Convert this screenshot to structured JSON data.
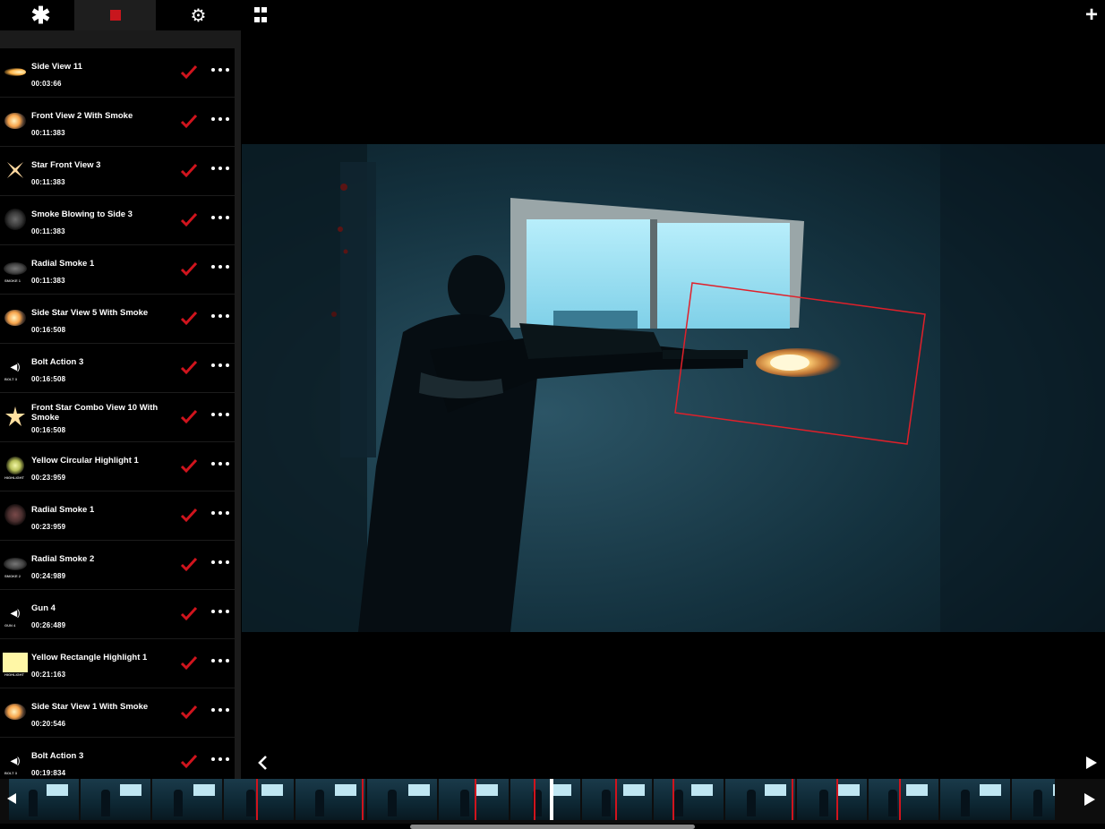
{
  "topbar": {
    "tabs": [
      {
        "name": "effects-tab",
        "glyph": "✱"
      },
      {
        "name": "record-tab",
        "glyph": ""
      },
      {
        "name": "settings-tab",
        "glyph": "⚙"
      }
    ],
    "plus_glyph": "+"
  },
  "effects": [
    {
      "name": "Side View 11",
      "time": "00:03:66",
      "thumb": "flash",
      "caption": ""
    },
    {
      "name": "Front View 2 With Smoke",
      "time": "00:11:383",
      "thumb": "smoke-flash",
      "caption": ""
    },
    {
      "name": "Star Front View 3",
      "time": "00:11:383",
      "thumb": "star-x",
      "caption": ""
    },
    {
      "name": "Smoke Blowing to Side 3",
      "time": "00:11:383",
      "thumb": "smoke",
      "caption": ""
    },
    {
      "name": "Radial Smoke 1",
      "time": "00:11:383",
      "thumb": "cloud",
      "caption": "SMOKE 1"
    },
    {
      "name": "Side Star View 5 With Smoke",
      "time": "00:16:508",
      "thumb": "smoke-flash",
      "caption": ""
    },
    {
      "name": "Bolt Action 3",
      "time": "00:16:508",
      "thumb": "speaker",
      "caption": "BOLT 3"
    },
    {
      "name": "Front Star Combo View 10 With Smoke",
      "time": "00:16:508",
      "thumb": "star",
      "caption": ""
    },
    {
      "name": "Yellow Circular Highlight 1",
      "time": "00:23:959",
      "thumb": "glow",
      "caption": "HIGHLIGHT"
    },
    {
      "name": "Radial Smoke 1",
      "time": "00:23:959",
      "thumb": "redsmoke",
      "caption": ""
    },
    {
      "name": "Radial Smoke 2",
      "time": "00:24:989",
      "thumb": "cloud",
      "caption": "SMOKE 2"
    },
    {
      "name": "Gun 4",
      "time": "00:26:489",
      "thumb": "speaker",
      "caption": "GUN 4"
    },
    {
      "name": "Yellow Rectangle Highlight 1",
      "time": "00:21:163",
      "thumb": "yellowrect",
      "caption": "HIGHLIGHT"
    },
    {
      "name": "Side Star View 1 With Smoke",
      "time": "00:20:546",
      "thumb": "smoke-flash",
      "caption": ""
    },
    {
      "name": "Bolt Action 3",
      "time": "00:19:834",
      "thumb": "speaker",
      "caption": "BOLT 3"
    }
  ],
  "colors": {
    "accent_red": "#c8161d",
    "check_red": "#d0141d",
    "sidebar_bg": "#1b1b1b",
    "selection_box": "#e0202a"
  },
  "icons": {
    "check": "checkmark-icon",
    "more": "ellipsis-icon",
    "prev": "chevron-left-icon",
    "play": "play-icon",
    "grid": "grid-icon",
    "settings": "gear-icon",
    "record": "stop-square-icon",
    "add": "plus-icon"
  }
}
